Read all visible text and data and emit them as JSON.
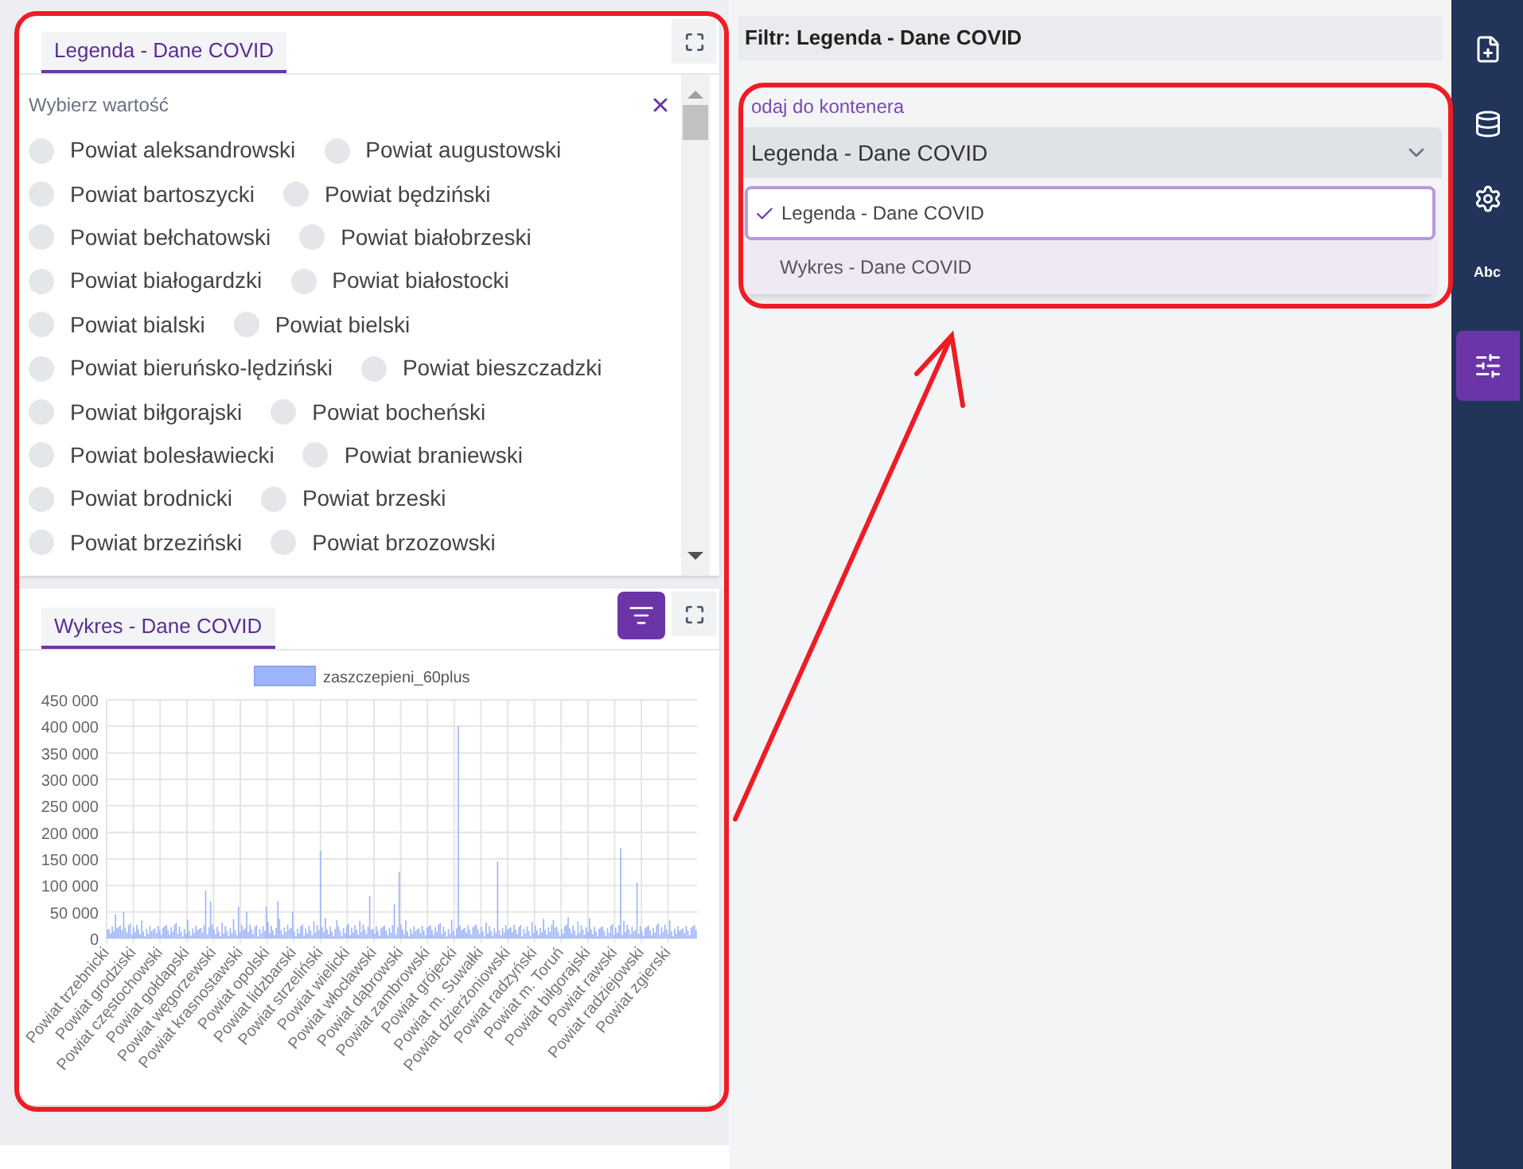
{
  "legend_card": {
    "tab": {
      "label": "Legenda - Dane COVID",
      "selected": true
    },
    "search": {
      "placeholder": "Wybierz wartość"
    },
    "options": [
      {
        "label": "Powiat aleksandrowski",
        "selected": false
      },
      {
        "label": "Powiat augustowski",
        "selected": false
      },
      {
        "label": "Powiat bartoszycki",
        "selected": false
      },
      {
        "label": "Powiat będziński",
        "selected": false
      },
      {
        "label": "Powiat bełchatowski",
        "selected": false
      },
      {
        "label": "Powiat białobrzeski",
        "selected": false
      },
      {
        "label": "Powiat białogardzki",
        "selected": false
      },
      {
        "label": "Powiat białostocki",
        "selected": false
      },
      {
        "label": "Powiat bialski",
        "selected": false
      },
      {
        "label": "Powiat bielski",
        "selected": false
      },
      {
        "label": "Powiat bieruńsko-lędziński",
        "selected": false
      },
      {
        "label": "Powiat bieszczadzki",
        "selected": false
      },
      {
        "label": "Powiat biłgorajski",
        "selected": false
      },
      {
        "label": "Powiat bocheński",
        "selected": false
      },
      {
        "label": "Powiat bolesławiecki",
        "selected": false
      },
      {
        "label": "Powiat braniewski",
        "selected": false
      },
      {
        "label": "Powiat brodnicki",
        "selected": false
      },
      {
        "label": "Powiat brzeski",
        "selected": false
      },
      {
        "label": "Powiat brzeziński",
        "selected": false
      },
      {
        "label": "Powiat brzozowski",
        "selected": false
      }
    ]
  },
  "chart_card": {
    "tab": {
      "label": "Wykres - Dane COVID",
      "selected": true
    },
    "filter_active": true,
    "legend": "zaszczepieni_60plus",
    "y_ticks": [
      "450 000",
      "400 000",
      "350 000",
      "300 000",
      "250 000",
      "200 000",
      "150 000",
      "100 000",
      "50 000",
      "0"
    ],
    "x_labels": [
      "Powiat trzebnicki",
      "Powiat grodziski",
      "Powiat częstochowski",
      "Powiat gołdapski",
      "Powiat węgorzewski",
      "Powiat krasnostawski",
      "Powiat opolski",
      "Powiat lidzbarski",
      "Powiat strzeliński",
      "Powiat wielicki",
      "Powiat włocławski",
      "Powiat dąbrowski",
      "Powiat zambrowski",
      "Powiat grójecki",
      "Powiat m. Suwałki",
      "Powiat dzierżoniowski",
      "Powiat radzyński",
      "Powiat m. Toruń",
      "Powiat biłgorajski",
      "Powiat rawski",
      "Powiat radziejowski",
      "Powiat zgierski"
    ]
  },
  "filter_panel": {
    "title": "Filtr: Legenda - Dane COVID",
    "field_label": "odaj do kontenera",
    "select": {
      "value": "Legenda - Dane COVID"
    },
    "options": [
      {
        "label": "Legenda - Dane COVID",
        "selected": true
      },
      {
        "label": "Wykres - Dane COVID",
        "selected": false
      }
    ]
  },
  "sidebar": {
    "items": [
      {
        "kind": "add-file",
        "selected": false
      },
      {
        "kind": "database",
        "selected": false
      },
      {
        "kind": "settings",
        "selected": false
      },
      {
        "kind": "text",
        "label": "Abc",
        "selected": false
      },
      {
        "kind": "sliders",
        "selected": true
      }
    ]
  }
}
